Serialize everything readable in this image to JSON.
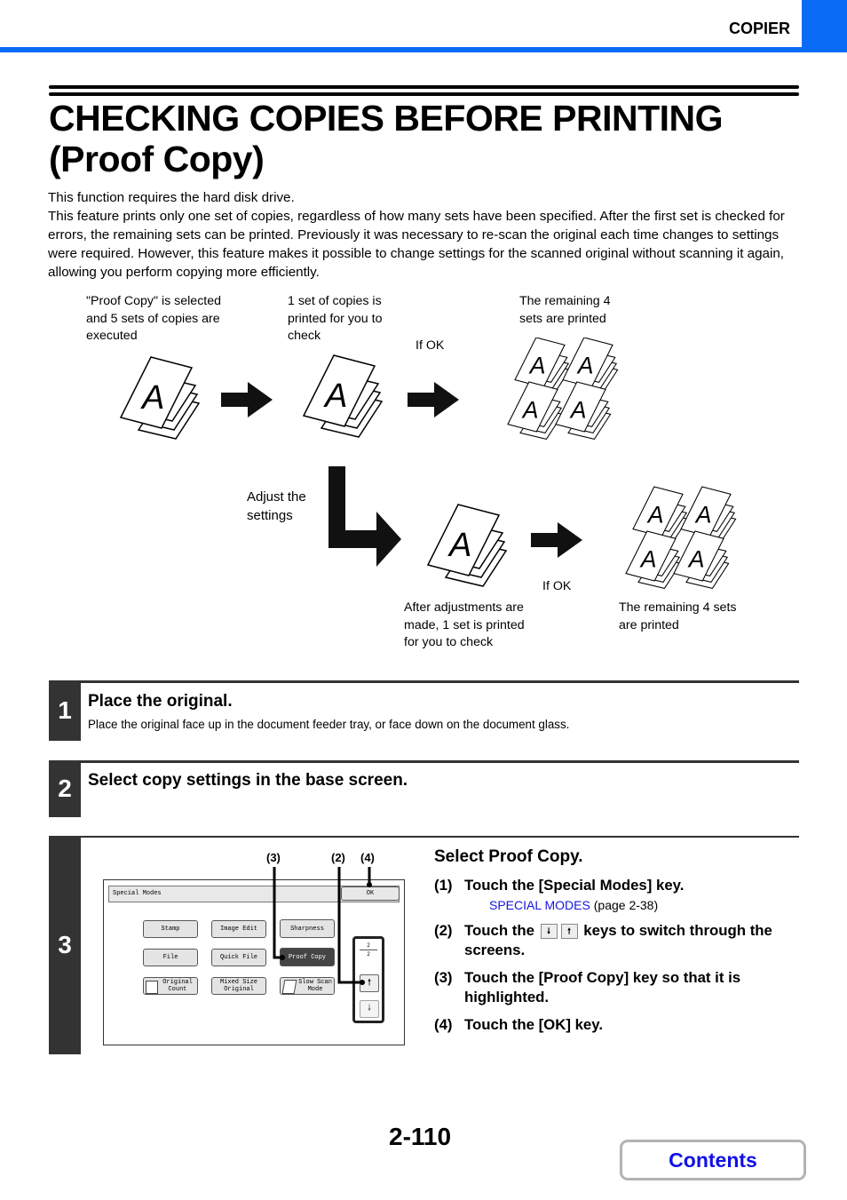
{
  "header": {
    "section": "COPIER",
    "accent_color": "#0a6cf5"
  },
  "title": {
    "line1": "CHECKING COPIES BEFORE PRINTING",
    "line2": "(Proof Copy)"
  },
  "intro": {
    "p1": "This function requires the hard disk drive.",
    "p2": "This feature prints only one set of copies, regardless of how many sets have been specified. After the first set is checked for errors, the remaining sets can be printed. Previously it was necessary to re-scan the original each time changes to settings were required. However, this feature makes it possible to change settings for the scanned original without scanning it again, allowing you perform copying more efficiently."
  },
  "diagram": {
    "cap1": "\"Proof Copy\" is selected and 5 sets of copies are executed",
    "cap2": "1 set of copies is printed for you to check",
    "cap3": "The remaining 4 sets are printed",
    "if_ok_1": "If OK",
    "adjust": "Adjust the settings",
    "cap4": "After adjustments are made, 1 set is printed for you to check",
    "if_ok_2": "If OK",
    "cap5": "The remaining 4 sets are printed",
    "page_glyph": "A"
  },
  "steps": [
    {
      "num": "1",
      "title": "Place the original.",
      "text": "Place the original face up in the document feeder tray, or face down on the document glass."
    },
    {
      "num": "2",
      "title": "Select copy settings in the base screen."
    },
    {
      "num": "3"
    }
  ],
  "screen": {
    "header": "Special Modes",
    "ok": "OK",
    "keys": [
      "Stamp",
      "Image Edit",
      "Sharpness",
      "File",
      "Quick File",
      "Proof Copy",
      "Original Count",
      "Mixed Size Original",
      "Slow Scan Mode"
    ],
    "page_current": "2",
    "page_total": "2",
    "callouts": [
      "(3)",
      "(2)",
      "(4)"
    ]
  },
  "instructions": {
    "heading": "Select Proof Copy.",
    "items": [
      {
        "n": "(1)",
        "text": "Touch the [Special Modes] key."
      },
      {
        "n": "(2)",
        "pre": "Touch the",
        "post": "keys to switch through the screens."
      },
      {
        "n": "(3)",
        "text": "Touch the [Proof Copy] key so that it is highlighted."
      },
      {
        "n": "(4)",
        "text": "Touch the [OK] key."
      }
    ],
    "link_text": "SPECIAL MODES",
    "link_ref": "(page 2-38)"
  },
  "footer": {
    "page": "2-110",
    "contents": "Contents"
  }
}
